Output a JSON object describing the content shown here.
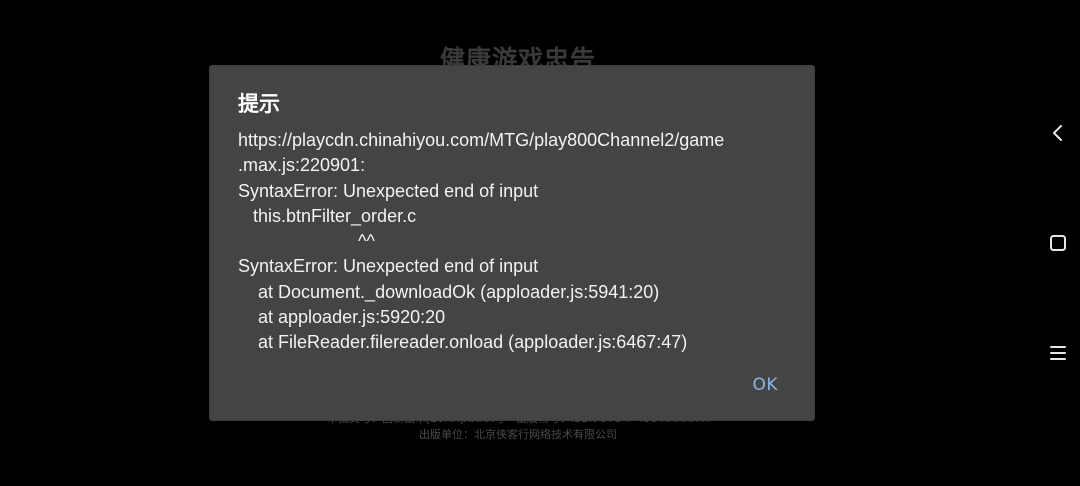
{
  "background": {
    "title": "健康游戏忠告",
    "footer_line1": "审批文号：国新出审[20XX]XXXX号　出版物号：ISBN 978-7-498-XXXXX-X",
    "footer_line2": "出版单位：北京侠客行网络技术有限公司"
  },
  "dialog": {
    "title": "提示",
    "message_lines": [
      "https://playcdn.chinahiyou.com/MTG/play800Channel2/game",
      ".max.js:220901:",
      "SyntaxError: Unexpected end of input",
      "   this.btnFilter_order.c",
      "                        ^^",
      "SyntaxError: Unexpected end of input",
      "    at Document._downloadOk (apploader.js:5941:20)",
      "    at apploader.js:5920:20",
      "    at FileReader.filereader.onload (apploader.js:6467:47)"
    ],
    "ok_label": "OK"
  },
  "nav": {
    "back_icon": "chevron-left-icon",
    "home_icon": "square-icon",
    "menu_icon": "menu-icon"
  },
  "colors": {
    "background": "#000000",
    "dialog": "#444444",
    "accent": "#8ab4e6"
  }
}
